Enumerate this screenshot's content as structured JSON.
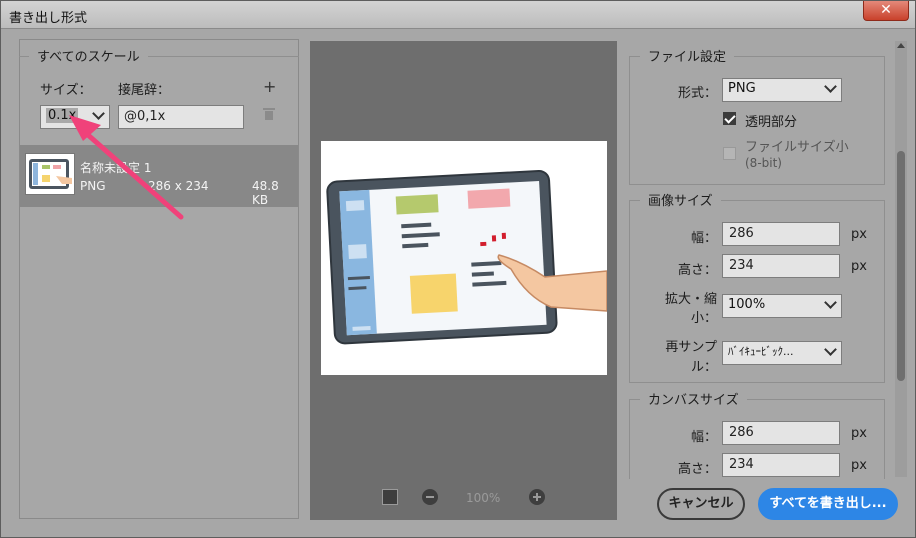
{
  "window": {
    "title": "書き出し形式",
    "close_label": "✕"
  },
  "scale": {
    "legend": "すべてのスケール",
    "size_label": "サイズ：",
    "suffix_label": "接尾辞：",
    "add_icon": "plus-icon",
    "delete_icon": "trash-icon",
    "size_value": "0.1x",
    "suffix_value": "@0,1x"
  },
  "asset": {
    "name": "名称未設定 1",
    "format": "PNG",
    "dimensions": "286 x 234",
    "filesize": "48.8 KB"
  },
  "preview": {
    "zoom": "100%"
  },
  "file_settings": {
    "legend": "ファイル設定",
    "format_label": "形式：",
    "format_value": "PNG",
    "transparency_label": "透明部分",
    "transparency_checked": true,
    "small_file_label": "ファイルサイズ小",
    "small_file_sub": "(8-bit)",
    "small_file_checked": false
  },
  "image_size": {
    "legend": "画像サイズ",
    "width_label": "幅：",
    "width_value": "286",
    "width_unit": "px",
    "height_label": "高さ：",
    "height_value": "234",
    "height_unit": "px",
    "scale_label_1": "拡大・縮",
    "scale_label_2": "小：",
    "scale_value": "100%",
    "resample_label_1": "再サンプ",
    "resample_label_2": "ル：",
    "resample_value": "ﾊﾞｲｷｭｰﾋﾞｯｸ..."
  },
  "canvas_size": {
    "legend": "カンバスサイズ",
    "width_label": "幅：",
    "width_value": "286",
    "width_unit": "px",
    "height_label": "高さ：",
    "height_value": "234",
    "height_unit": "px"
  },
  "buttons": {
    "cancel": "キャンセル",
    "export": "すべてを書き出し..."
  },
  "colors": {
    "accent": "#2d86e6",
    "annotation_arrow": "#f0427a"
  }
}
